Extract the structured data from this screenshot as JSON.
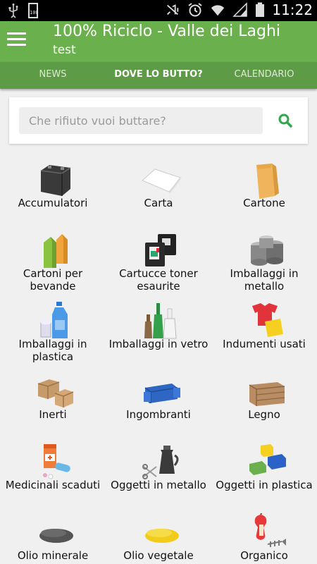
{
  "status_bar": {
    "time": "11:22",
    "icons": [
      "usb-icon",
      "battery-100-icon",
      "mute-icon",
      "alarm-icon",
      "wifi-icon",
      "signal-icon",
      "battery-icon"
    ],
    "battery_label": "100"
  },
  "app_bar": {
    "title": "100% Riciclo - Valle dei Laghi",
    "subtitle": "test"
  },
  "tabs": [
    {
      "label": "NEWS",
      "active": false
    },
    {
      "label": "DOVE LO BUTTO?",
      "active": true
    },
    {
      "label": "CALENDARIO",
      "active": false
    }
  ],
  "search": {
    "placeholder": "Che rifiuto vuoi buttare?",
    "value": "",
    "icon": "search-icon",
    "accent": "#2ea84a"
  },
  "colors": {
    "app_bar": "#6ab04c",
    "tabs": "#5e9b46",
    "background": "#f0f0f0"
  },
  "categories": [
    {
      "label": "Accumulatori",
      "icon": "car-battery-icon"
    },
    {
      "label": "Carta",
      "icon": "paper-sheet-icon"
    },
    {
      "label": "Cartone",
      "icon": "cardboard-bag-icon"
    },
    {
      "label": "Cartoni per bevande",
      "icon": "drink-cartons-icon"
    },
    {
      "label": "Cartucce toner esaurite",
      "icon": "ink-cartridges-icon"
    },
    {
      "label": "Imballaggi in metallo",
      "icon": "metal-cans-icon"
    },
    {
      "label": "Imballaggi in plastica",
      "icon": "plastic-bottles-icon"
    },
    {
      "label": "Imballaggi in vetro",
      "icon": "glass-bottles-icon"
    },
    {
      "label": "Indumenti usati",
      "icon": "used-clothes-icon"
    },
    {
      "label": "Inerti",
      "icon": "bricks-icon"
    },
    {
      "label": "Ingombranti",
      "icon": "sofa-icon"
    },
    {
      "label": "Legno",
      "icon": "wooden-crate-icon"
    },
    {
      "label": "Medicinali scaduti",
      "icon": "medicines-icon"
    },
    {
      "label": "Oggetti in metallo",
      "icon": "metal-objects-icon"
    },
    {
      "label": "Oggetti in plastica",
      "icon": "plastic-blocks-icon"
    },
    {
      "label": "Olio minerale",
      "icon": "mineral-oil-icon"
    },
    {
      "label": "Olio vegetale",
      "icon": "vegetable-oil-icon"
    },
    {
      "label": "Organico",
      "icon": "organic-waste-icon"
    }
  ]
}
